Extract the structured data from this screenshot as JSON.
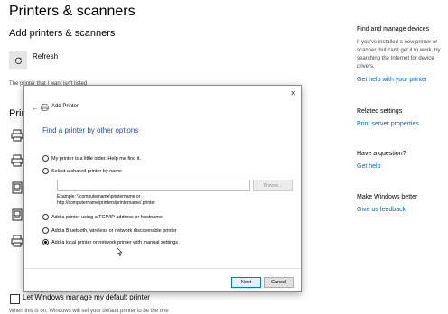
{
  "page": {
    "title": "Printers & scanners",
    "add_section_title": "Add printers & scanners",
    "refresh_label": "Refresh",
    "cut_text": "The printer that I want isn't listed",
    "printers_heading": "Prin",
    "manage_checkbox_label": "Let Windows manage my default printer",
    "bottom_cut_text": "When this is on, Windows will set your default printer to be the one"
  },
  "right_panel": {
    "find_title": "Find and manage devices",
    "find_text_1": "If you've installed a new printer or",
    "find_text_2": "scanner, but can't get it to work, try",
    "find_text_3": "searching the Internet for device",
    "find_text_4": "drivers.",
    "help_link": "Get help with your printer",
    "related_title": "Related settings",
    "print_server_link": "Print server properties",
    "question_title": "Have a question?",
    "get_help_link": "Get help",
    "better_title": "Make Windows better",
    "feedback_link": "Give us feedback"
  },
  "dialog": {
    "close_glyph": "✕",
    "back_glyph": "←",
    "title": "Add Printer",
    "heading": "Find a printer by other options",
    "options": [
      {
        "label": "My printer is a little older. Help me find it.",
        "selected": false
      },
      {
        "label": "Select a shared printer by name",
        "selected": false
      },
      {
        "label": "Add a printer using a TCP/IP address or hostname",
        "selected": false
      },
      {
        "label": "Add a Bluetooth, wireless or network discoverable printer",
        "selected": false
      },
      {
        "label": "Add a local printer or network printer with manual settings",
        "selected": true
      }
    ],
    "shared_input_value": "",
    "browse_label": "Browse...",
    "example_line_1": "Example: \\\\computername\\printername or",
    "example_line_2": "http://computername/printers/printername/.printer",
    "next_label": "Next",
    "cancel_label": "Cancel"
  },
  "colors": {
    "accent": "#0078d7",
    "link": "#0066b4",
    "dialog_heading": "#1e4e9c"
  }
}
